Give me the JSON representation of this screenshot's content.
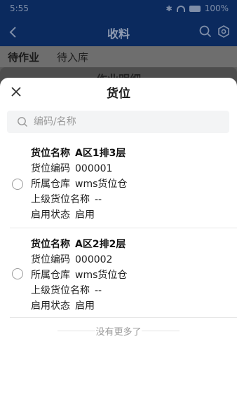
{
  "status_bar": {
    "time": "5:55",
    "bluetooth_icon": "bluetooth-icon",
    "wifi_icon": "wifi-icon",
    "battery": "100%"
  },
  "app_header": {
    "title": "收料",
    "back_icon": "back-arrow-icon",
    "search_icon": "search-icon",
    "settings_icon": "settings-icon"
  },
  "tabs": {
    "active": "待作业",
    "inactive": "待入库"
  },
  "underlay": {
    "title": "作业明细"
  },
  "sheet": {
    "title": "货位",
    "close_icon": "close-icon",
    "search": {
      "placeholder": "编码/名称",
      "value": ""
    },
    "items": [
      {
        "name_label": "货位名称",
        "name_value": "A区1排3层",
        "code_label": "货位编码",
        "code_value": "000001",
        "warehouse_label": "所属仓库",
        "warehouse_value": "wms货位仓",
        "parent_label": "上级货位名称",
        "parent_value": "--",
        "status_label": "启用状态",
        "status_value": "启用",
        "selected": false
      },
      {
        "name_label": "货位名称",
        "name_value": "A区2排2层",
        "code_label": "货位编码",
        "code_value": "000002",
        "warehouse_label": "所属仓库",
        "warehouse_value": "wms货位仓",
        "parent_label": "上级货位名称",
        "parent_value": "--",
        "status_label": "启用状态",
        "status_value": "启用",
        "selected": false
      }
    ],
    "no_more_text": "没有更多了"
  },
  "colors": {
    "header_bg": "#0b2a5e",
    "overlay": "#5a5a5a",
    "sheet_bg": "#ffffff",
    "radio_border": "#9b9b9b"
  }
}
